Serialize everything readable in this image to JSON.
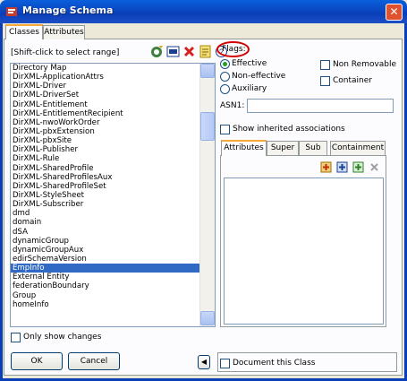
{
  "window": {
    "title": "Manage Schema",
    "close_glyph": "✕"
  },
  "tabs": [
    "Classes",
    "Attributes"
  ],
  "left": {
    "hint": "[Shift-click to select range]",
    "items": [
      "Directory Map",
      "DirXML-ApplicationAttrs",
      "DirXML-Driver",
      "DirXML-DriverSet",
      "DirXML-Entitlement",
      "DirXML-EntitlementRecipient",
      "DirXML-nwoWorkOrder",
      "DirXML-pbxExtension",
      "DirXML-pbxSite",
      "DirXML-Publisher",
      "DirXML-Rule",
      "DirXML-SharedProfile",
      "DirXML-SharedProfilesAux",
      "DirXML-SharedProfileSet",
      "DirXML-StyleSheet",
      "DirXML-Subscriber",
      "dmd",
      "domain",
      "dSA",
      "dynamicGroup",
      "dynamicGroupAux",
      "edirSchemaVersion",
      "EmpInfo",
      "External Entity",
      "federationBoundary",
      "Group",
      "homeInfo"
    ],
    "selected": "EmpInfo",
    "only_changes": "Only show changes"
  },
  "flags": {
    "label": "Flags:",
    "effective": "Effective",
    "non_effective": "Non-effective",
    "auxiliary": "Auxiliary",
    "non_removable": "Non Removable",
    "container": "Container",
    "asn1": "ASN1:"
  },
  "show_inherited": "Show inherited associations",
  "subtabs": [
    "Attributes",
    "Super",
    "Sub",
    "Containment"
  ],
  "document_class": "Document this Class",
  "buttons": {
    "ok": "OK",
    "cancel": "Cancel",
    "collapse": "◀"
  },
  "toolbar_icons": [
    "add-class-icon",
    "edit-class-icon",
    "delete-icon",
    "properties-icon",
    "help-icon"
  ],
  "attr_icons": [
    "add-attribute-icon",
    "add-optional-icon",
    "add-naming-icon",
    "remove-attribute-icon"
  ]
}
